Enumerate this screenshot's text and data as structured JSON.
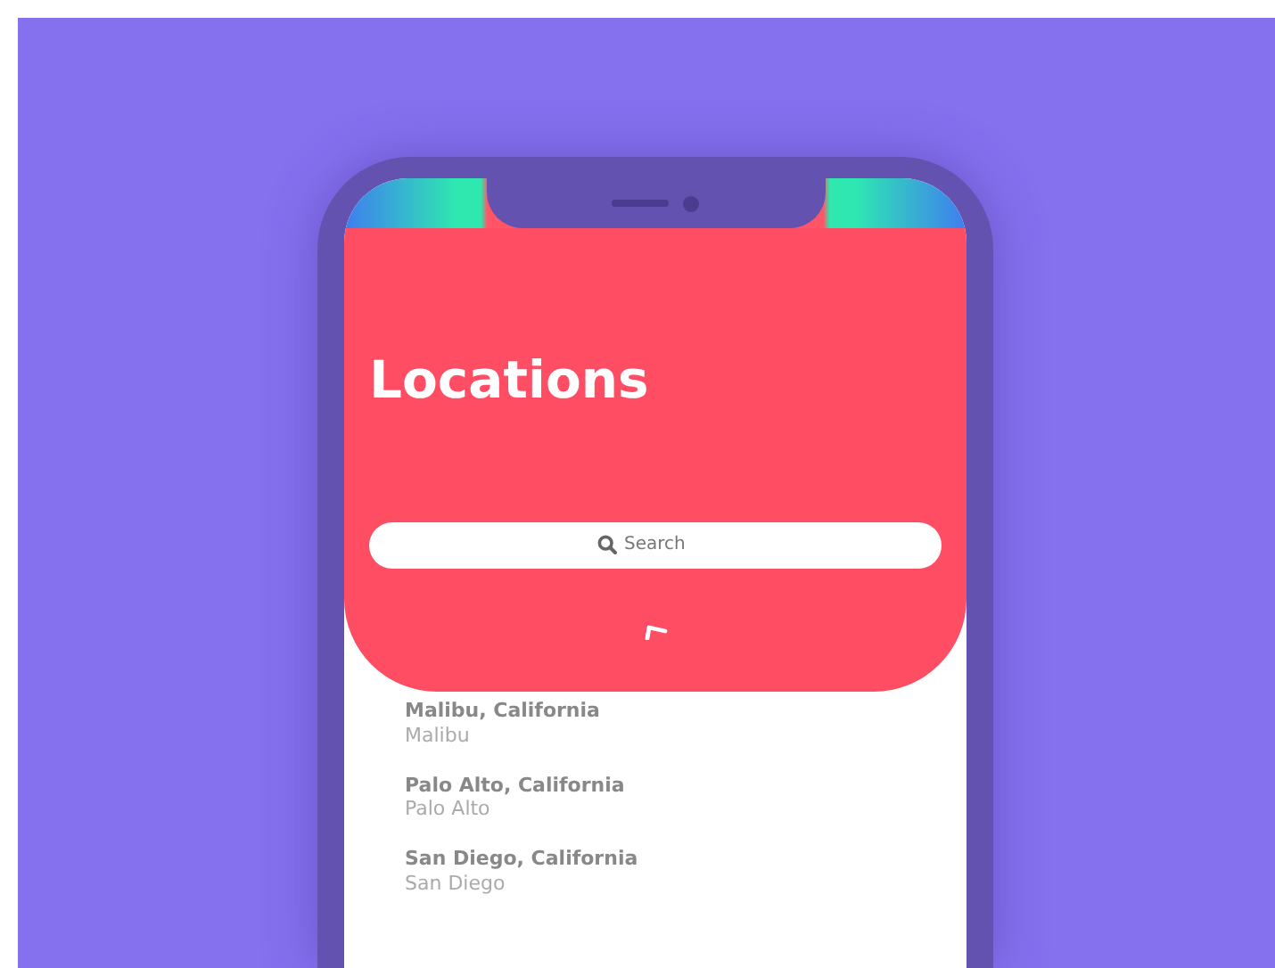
{
  "header": {
    "title": "Locations"
  },
  "search": {
    "placeholder": "Search"
  },
  "locations": [
    {
      "name": "Malibu, California",
      "subtitle": "Malibu"
    },
    {
      "name": "Palo Alto, California",
      "subtitle": "Palo Alto"
    },
    {
      "name": "San Diego, California",
      "subtitle": "San Diego"
    }
  ]
}
